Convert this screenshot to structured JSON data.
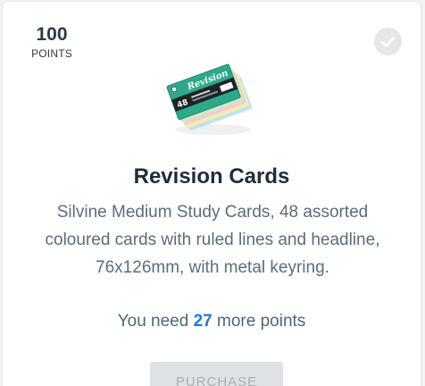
{
  "card": {
    "points": {
      "value": "100",
      "label": "POINTS"
    },
    "status_icon": "check-circle-icon",
    "product_image_text": {
      "brand": "Revision",
      "count": "48"
    },
    "title": "Revision Cards",
    "description": "Silvine Medium Study Cards, 48 assorted coloured cards with ruled lines and headline, 76x126mm, with metal keyring.",
    "need": {
      "prefix": "You need",
      "amount": "27",
      "suffix": "more points"
    },
    "purchase_label": "PURCHASE"
  },
  "colors": {
    "accent": "#1f7ad1",
    "title": "#1f2d3a",
    "body_text": "#5a6d7b",
    "disabled_button_bg": "#dfe2e4",
    "disabled_button_text": "#a9b0b5"
  }
}
